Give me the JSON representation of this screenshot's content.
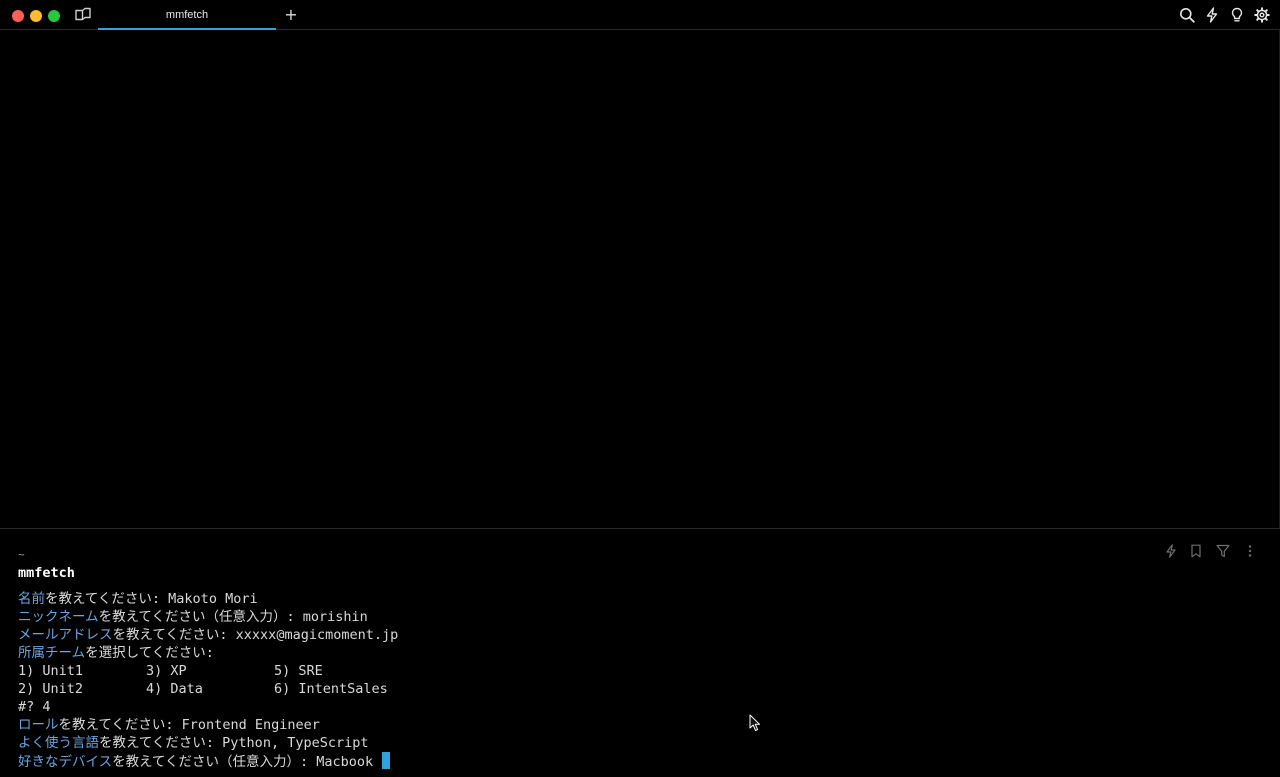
{
  "tab": {
    "title": "mmfetch"
  },
  "new_tab_symbol": "+",
  "block": {
    "cwd": "~",
    "command": "mmfetch",
    "lines": [
      {
        "label": "名前",
        "rest": "を教えてください: Makoto Mori"
      },
      {
        "label": "ニックネーム",
        "rest": "を教えてください（任意入力）: morishin"
      },
      {
        "label": "メールアドレス",
        "rest": "を教えてください: xxxxx@magicmoment.jp"
      },
      {
        "label": "所属チーム",
        "rest": "を選択してください:"
      }
    ],
    "options": [
      [
        "1) Unit1",
        "3) XP",
        "5) SRE"
      ],
      [
        "2) Unit2",
        "4) Data",
        "6) IntentSales"
      ]
    ],
    "selection": "#? 4",
    "after_lines": [
      {
        "label": "ロール",
        "rest": "を教えてください: Frontend Engineer"
      },
      {
        "label": "よく使う言語",
        "rest": "を教えてください: Python, TypeScript"
      },
      {
        "label": "好きなデバイス",
        "rest": "を教えてください（任意入力）: Macbook"
      }
    ]
  },
  "colors": {
    "accent": "#2ea3e0",
    "label": "#6aa5df",
    "background": "#000000",
    "text": "#d9d9d9"
  },
  "icons": {
    "window": [
      "close-button",
      "minimize-button",
      "zoom-button",
      "sidebar-toggle-icon"
    ],
    "top_right": [
      "search-icon",
      "lightning-icon",
      "lightbulb-icon",
      "gear-icon"
    ],
    "block_toolbar": [
      "lightning-icon",
      "bookmark-icon",
      "filter-icon",
      "more-vertical-icon"
    ]
  }
}
